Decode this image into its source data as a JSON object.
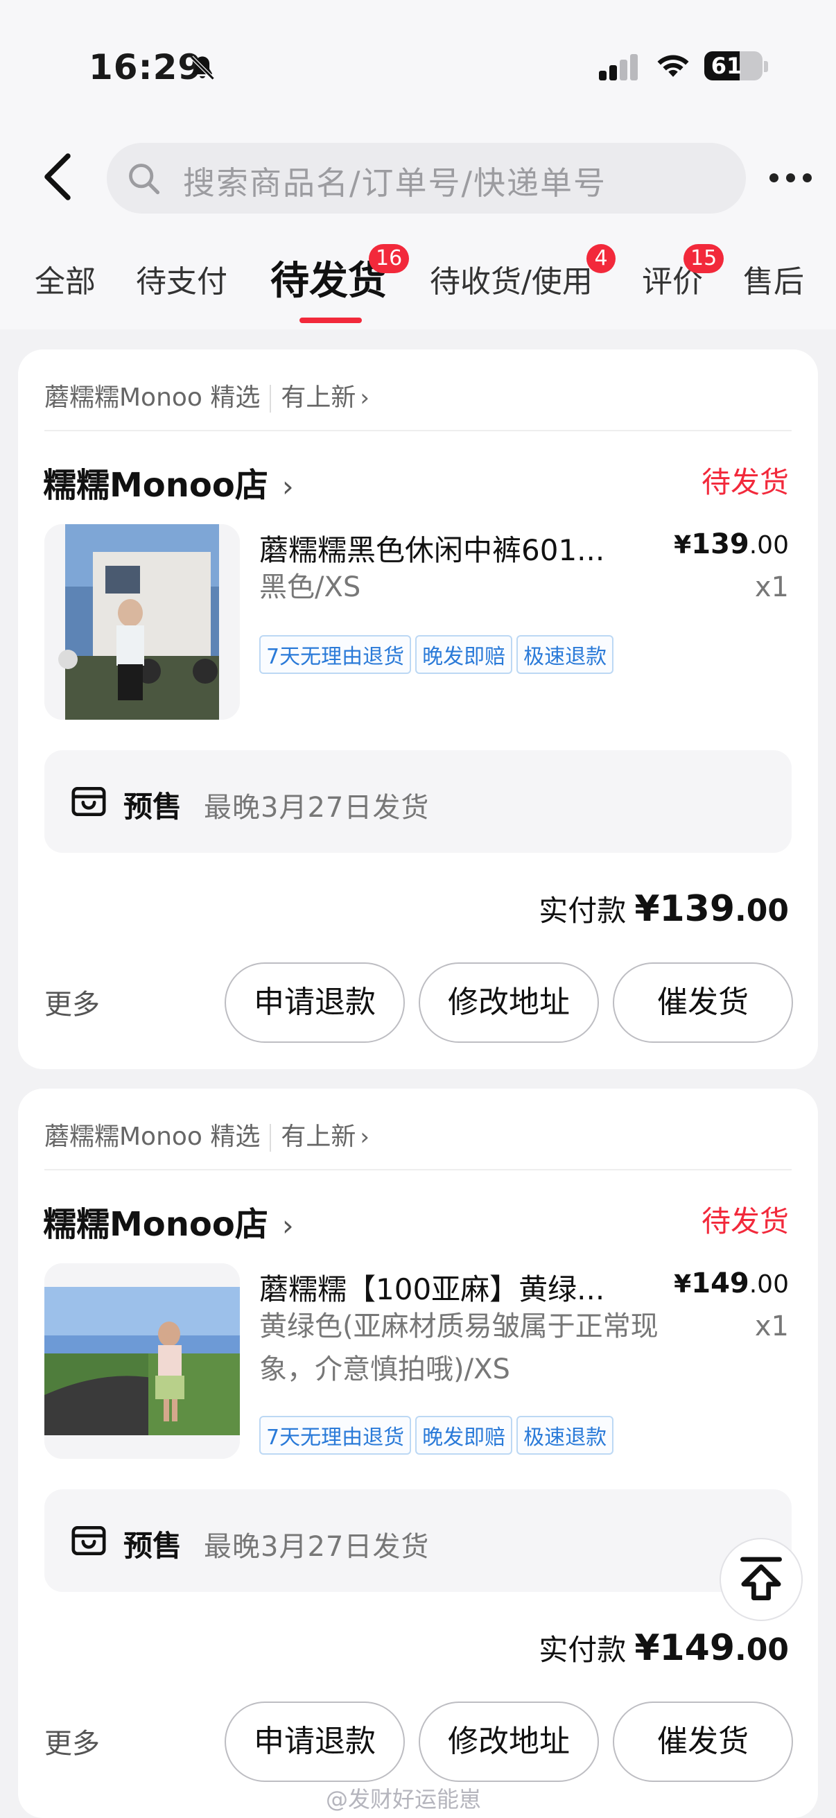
{
  "status_bar": {
    "time": "16:29",
    "battery": "61",
    "battery_level": 0.61
  },
  "search": {
    "placeholder": "搜索商品名/订单号/快递单号"
  },
  "tabs": [
    {
      "label": "全部"
    },
    {
      "label": "待支付"
    },
    {
      "label": "待发货",
      "badge": "16",
      "active": true
    },
    {
      "label": "待收货/使用",
      "badge": "4"
    },
    {
      "label": "评价",
      "badge": "15"
    },
    {
      "label": "售后"
    }
  ],
  "orders": [
    {
      "source": "蘑糯糯Monoo 精选",
      "source_link": "有上新",
      "shop": "糯糯Monoo店",
      "state": "待发货",
      "product_name": "蘑糯糯黑色休闲中裤601...",
      "price_symbol": "¥",
      "price_int": "139",
      "price_dec": ".00",
      "spec": "黑色/XS",
      "qty": "x1",
      "tags": [
        "7天无理由退货",
        "晚发即赔",
        "极速退款"
      ],
      "presale_label": "预售",
      "presale_text": "最晚3月27日发货",
      "paid_label": "实付款",
      "paid_int": "¥139",
      "paid_dec": ".00",
      "more": "更多",
      "buttons": [
        "申请退款",
        "修改地址",
        "催发货"
      ]
    },
    {
      "source": "蘑糯糯Monoo 精选",
      "source_link": "有上新",
      "shop": "糯糯Monoo店",
      "state": "待发货",
      "product_name": "蘑糯糯【100亚麻】黄绿...",
      "price_symbol": "¥",
      "price_int": "149",
      "price_dec": ".00",
      "spec": "黄绿色(亚麻材质易皱属于正常现象，介意慎拍哦)/XS",
      "qty": "x1",
      "tags": [
        "7天无理由退货",
        "晚发即赔",
        "极速退款"
      ],
      "presale_label": "预售",
      "presale_text": "最晚3月27日发货",
      "paid_label": "实付款",
      "paid_int": "¥149",
      "paid_dec": ".00",
      "more": "更多",
      "buttons": [
        "申请退款",
        "修改地址",
        "催发货"
      ]
    }
  ],
  "watermark": "@发财好运能崽",
  "colors": {
    "accent": "#f2293b",
    "tag_blue": "#2a7ad8",
    "background": "#f2f2f4"
  },
  "icons": [
    "bell-slash-icon",
    "signal-icon",
    "wifi-icon",
    "battery-icon",
    "back-arrow-icon",
    "search-icon",
    "more-dots-icon",
    "chevron-right-icon",
    "presale-box-icon",
    "back-to-top-icon"
  ]
}
